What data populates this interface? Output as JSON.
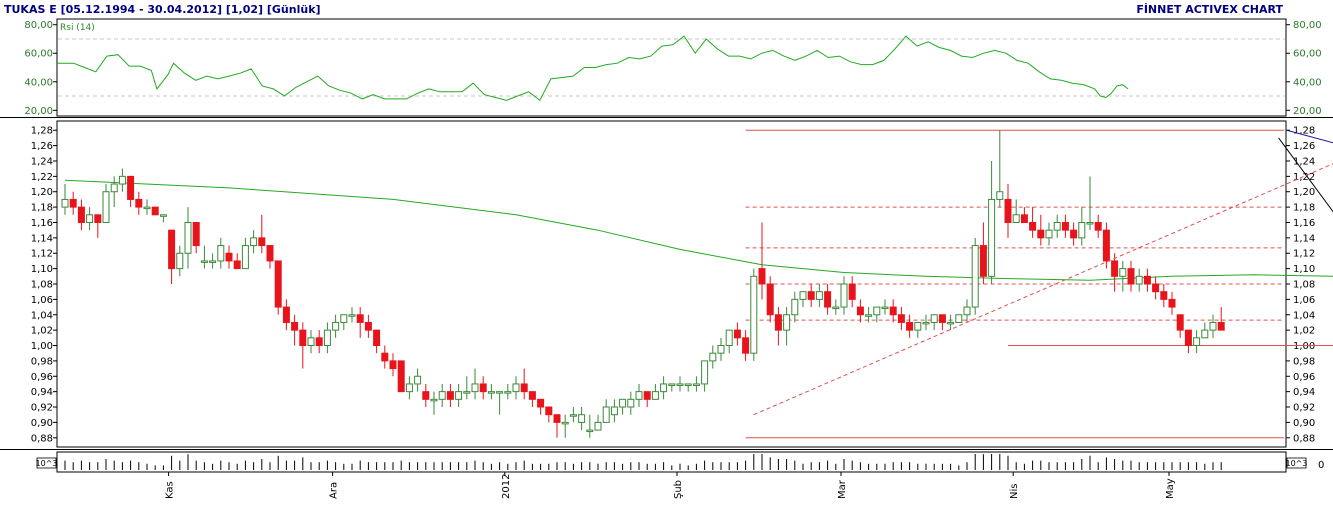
{
  "header": {
    "title": "TUKAS E  [05.12.1994 - 30.04.2012]  [1,02]  [Günlük]",
    "brand": "FİNNET ACTIVEX CHART"
  },
  "colors": {
    "frame": "#000000",
    "up_candle": "#3a8a3a",
    "down_candle": "#e8141c",
    "ma_line": "#22aa22",
    "rsi_line": "#22aa22",
    "level_line": "#e05050",
    "trend_blue": "#1a1a9a",
    "trend_black": "#000000",
    "grid_dash": "#c8c8c8",
    "header_text": "#000080"
  },
  "rsi_panel": {
    "label": "Rsi (14)",
    "ticks": [
      "80,00",
      "60,00",
      "40,00",
      "20,00"
    ],
    "tick_values": [
      80,
      60,
      40,
      20
    ],
    "range": [
      16,
      84
    ]
  },
  "volume_panel": {
    "left_label": "10^3",
    "right_label": "10^3",
    "right_zero": "0"
  },
  "chart_data": {
    "type": "candlestick",
    "y_axis": {
      "range": [
        0.868,
        1.292
      ],
      "ticks": [
        "1,28",
        "1,26",
        "1,24",
        "1,22",
        "1,20",
        "1,18",
        "1,16",
        "1,14",
        "1,12",
        "1,10",
        "1,08",
        "1,06",
        "1,04",
        "1,02",
        "1,00",
        "0,98",
        "0,96",
        "0,94",
        "0,92",
        "0,90",
        "0,88"
      ],
      "tick_values": [
        1.28,
        1.26,
        1.24,
        1.22,
        1.2,
        1.18,
        1.16,
        1.14,
        1.12,
        1.1,
        1.08,
        1.06,
        1.04,
        1.02,
        1.0,
        0.98,
        0.96,
        0.94,
        0.92,
        0.9,
        0.88
      ]
    },
    "x_axis": {
      "months": [
        "Kas",
        "Ara",
        "2012",
        "Şub",
        "Mar",
        "Nis",
        "May"
      ],
      "month_start_index": [
        13,
        33,
        54,
        75,
        95,
        116,
        135
      ]
    },
    "candles": [
      [
        1.18,
        1.21,
        1.17,
        1.19
      ],
      [
        1.19,
        1.2,
        1.17,
        1.18
      ],
      [
        1.18,
        1.19,
        1.15,
        1.16
      ],
      [
        1.16,
        1.18,
        1.15,
        1.17
      ],
      [
        1.17,
        1.17,
        1.14,
        1.16
      ],
      [
        1.16,
        1.21,
        1.16,
        1.2
      ],
      [
        1.2,
        1.22,
        1.18,
        1.21
      ],
      [
        1.21,
        1.23,
        1.2,
        1.22
      ],
      [
        1.22,
        1.22,
        1.18,
        1.19
      ],
      [
        1.19,
        1.2,
        1.17,
        1.18
      ],
      [
        1.18,
        1.19,
        1.17,
        1.18
      ],
      [
        1.18,
        1.18,
        1.17,
        1.17
      ],
      [
        1.17,
        1.17,
        1.16,
        1.17
      ],
      [
        1.15,
        1.15,
        1.08,
        1.1
      ],
      [
        1.1,
        1.13,
        1.09,
        1.12
      ],
      [
        1.12,
        1.18,
        1.1,
        1.16
      ],
      [
        1.16,
        1.16,
        1.12,
        1.13
      ],
      [
        1.11,
        1.13,
        1.1,
        1.11
      ],
      [
        1.11,
        1.12,
        1.1,
        1.11
      ],
      [
        1.11,
        1.14,
        1.1,
        1.13
      ],
      [
        1.12,
        1.13,
        1.1,
        1.11
      ],
      [
        1.11,
        1.12,
        1.1,
        1.1
      ],
      [
        1.1,
        1.14,
        1.1,
        1.13
      ],
      [
        1.13,
        1.15,
        1.12,
        1.14
      ],
      [
        1.14,
        1.17,
        1.12,
        1.13
      ],
      [
        1.13,
        1.13,
        1.1,
        1.11
      ],
      [
        1.11,
        1.11,
        1.04,
        1.05
      ],
      [
        1.05,
        1.06,
        1.02,
        1.03
      ],
      [
        1.03,
        1.04,
        1.0,
        1.02
      ],
      [
        1.02,
        1.03,
        0.97,
        1.0
      ],
      [
        1.0,
        1.02,
        0.99,
        1.01
      ],
      [
        1.01,
        1.02,
        0.99,
        1.0
      ],
      [
        1.0,
        1.03,
        0.99,
        1.02
      ],
      [
        1.02,
        1.04,
        1.01,
        1.03
      ],
      [
        1.03,
        1.04,
        1.02,
        1.04
      ],
      [
        1.04,
        1.05,
        1.03,
        1.04
      ],
      [
        1.04,
        1.05,
        1.01,
        1.03
      ],
      [
        1.03,
        1.04,
        1.01,
        1.02
      ],
      [
        1.02,
        1.02,
        0.99,
        1.0
      ],
      [
        0.99,
        1.0,
        0.97,
        0.98
      ],
      [
        0.98,
        0.99,
        0.96,
        0.97
      ],
      [
        0.98,
        0.98,
        0.94,
        0.94
      ],
      [
        0.94,
        0.96,
        0.93,
        0.95
      ],
      [
        0.95,
        0.97,
        0.94,
        0.96
      ],
      [
        0.94,
        0.95,
        0.92,
        0.93
      ],
      [
        0.93,
        0.94,
        0.91,
        0.93
      ],
      [
        0.93,
        0.95,
        0.92,
        0.94
      ],
      [
        0.94,
        0.95,
        0.92,
        0.93
      ],
      [
        0.93,
        0.95,
        0.92,
        0.94
      ],
      [
        0.94,
        0.96,
        0.93,
        0.94
      ],
      [
        0.94,
        0.97,
        0.93,
        0.95
      ],
      [
        0.95,
        0.96,
        0.93,
        0.94
      ],
      [
        0.94,
        0.95,
        0.93,
        0.94
      ],
      [
        0.94,
        0.94,
        0.91,
        0.94
      ],
      [
        0.94,
        0.95,
        0.93,
        0.94
      ],
      [
        0.94,
        0.96,
        0.93,
        0.95
      ],
      [
        0.95,
        0.97,
        0.93,
        0.94
      ],
      [
        0.94,
        0.94,
        0.92,
        0.93
      ],
      [
        0.93,
        0.93,
        0.91,
        0.92
      ],
      [
        0.92,
        0.92,
        0.9,
        0.91
      ],
      [
        0.91,
        0.91,
        0.88,
        0.9
      ],
      [
        0.9,
        0.91,
        0.88,
        0.9
      ],
      [
        0.91,
        0.92,
        0.9,
        0.91
      ],
      [
        0.9,
        0.92,
        0.89,
        0.91
      ],
      [
        0.89,
        0.91,
        0.88,
        0.89
      ],
      [
        0.89,
        0.91,
        0.89,
        0.9
      ],
      [
        0.9,
        0.93,
        0.9,
        0.92
      ],
      [
        0.91,
        0.93,
        0.9,
        0.92
      ],
      [
        0.92,
        0.93,
        0.91,
        0.93
      ],
      [
        0.92,
        0.94,
        0.91,
        0.93
      ],
      [
        0.93,
        0.95,
        0.92,
        0.94
      ],
      [
        0.94,
        0.94,
        0.92,
        0.93
      ],
      [
        0.93,
        0.95,
        0.93,
        0.94
      ],
      [
        0.94,
        0.96,
        0.93,
        0.95
      ],
      [
        0.95,
        0.95,
        0.94,
        0.95
      ],
      [
        0.95,
        0.96,
        0.94,
        0.95
      ],
      [
        0.95,
        0.95,
        0.94,
        0.95
      ],
      [
        0.95,
        0.96,
        0.94,
        0.95
      ],
      [
        0.95,
        0.98,
        0.94,
        0.98
      ],
      [
        0.98,
        1.0,
        0.97,
        0.99
      ],
      [
        0.99,
        1.01,
        0.98,
        1.0
      ],
      [
        1.0,
        1.02,
        0.99,
        1.02
      ],
      [
        1.02,
        1.03,
        1.0,
        1.01
      ],
      [
        1.01,
        1.02,
        0.98,
        0.99
      ],
      [
        0.99,
        1.1,
        0.98,
        1.09
      ],
      [
        1.1,
        1.16,
        1.06,
        1.08
      ],
      [
        1.08,
        1.09,
        1.03,
        1.04
      ],
      [
        1.04,
        1.05,
        1.0,
        1.02
      ],
      [
        1.02,
        1.05,
        1.0,
        1.04
      ],
      [
        1.04,
        1.07,
        1.03,
        1.06
      ],
      [
        1.06,
        1.07,
        1.05,
        1.07
      ],
      [
        1.07,
        1.08,
        1.05,
        1.06
      ],
      [
        1.06,
        1.08,
        1.05,
        1.07
      ],
      [
        1.07,
        1.08,
        1.04,
        1.05
      ],
      [
        1.05,
        1.06,
        1.04,
        1.05
      ],
      [
        1.05,
        1.09,
        1.04,
        1.08
      ],
      [
        1.08,
        1.09,
        1.05,
        1.06
      ],
      [
        1.05,
        1.06,
        1.03,
        1.04
      ],
      [
        1.04,
        1.05,
        1.03,
        1.04
      ],
      [
        1.04,
        1.05,
        1.03,
        1.05
      ],
      [
        1.05,
        1.06,
        1.04,
        1.05
      ],
      [
        1.05,
        1.06,
        1.03,
        1.04
      ],
      [
        1.04,
        1.05,
        1.02,
        1.03
      ],
      [
        1.03,
        1.04,
        1.01,
        1.02
      ],
      [
        1.02,
        1.03,
        1.01,
        1.03
      ],
      [
        1.03,
        1.04,
        1.02,
        1.03
      ],
      [
        1.03,
        1.04,
        1.02,
        1.04
      ],
      [
        1.04,
        1.04,
        1.02,
        1.03
      ],
      [
        1.03,
        1.04,
        1.02,
        1.03
      ],
      [
        1.03,
        1.04,
        1.03,
        1.04
      ],
      [
        1.04,
        1.06,
        1.03,
        1.05
      ],
      [
        1.05,
        1.14,
        1.04,
        1.13
      ],
      [
        1.13,
        1.16,
        1.08,
        1.09
      ],
      [
        1.09,
        1.24,
        1.08,
        1.19
      ],
      [
        1.19,
        1.28,
        1.18,
        1.2
      ],
      [
        1.19,
        1.21,
        1.14,
        1.16
      ],
      [
        1.16,
        1.19,
        1.16,
        1.17
      ],
      [
        1.17,
        1.18,
        1.16,
        1.16
      ],
      [
        1.16,
        1.18,
        1.14,
        1.15
      ],
      [
        1.15,
        1.17,
        1.13,
        1.14
      ],
      [
        1.14,
        1.16,
        1.13,
        1.15
      ],
      [
        1.15,
        1.17,
        1.14,
        1.16
      ],
      [
        1.16,
        1.17,
        1.14,
        1.15
      ],
      [
        1.15,
        1.16,
        1.13,
        1.14
      ],
      [
        1.14,
        1.18,
        1.13,
        1.16
      ],
      [
        1.16,
        1.22,
        1.15,
        1.16
      ],
      [
        1.16,
        1.17,
        1.14,
        1.15
      ],
      [
        1.15,
        1.16,
        1.1,
        1.11
      ],
      [
        1.11,
        1.12,
        1.07,
        1.09
      ],
      [
        1.09,
        1.11,
        1.07,
        1.1
      ],
      [
        1.1,
        1.11,
        1.07,
        1.08
      ],
      [
        1.08,
        1.1,
        1.07,
        1.09
      ],
      [
        1.09,
        1.1,
        1.07,
        1.08
      ],
      [
        1.08,
        1.09,
        1.06,
        1.07
      ],
      [
        1.07,
        1.08,
        1.05,
        1.06
      ],
      [
        1.06,
        1.07,
        1.04,
        1.05
      ],
      [
        1.04,
        1.04,
        1.01,
        1.02
      ],
      [
        1.02,
        1.02,
        0.99,
        1.0
      ],
      [
        1.0,
        1.02,
        0.99,
        1.01
      ],
      [
        1.01,
        1.03,
        1.01,
        1.02
      ],
      [
        1.02,
        1.04,
        1.01,
        1.03
      ],
      [
        1.03,
        1.05,
        1.02,
        1.02
      ]
    ],
    "moving_average": [
      [
        0,
        1.215
      ],
      [
        20,
        1.205
      ],
      [
        40,
        1.19
      ],
      [
        55,
        1.17
      ],
      [
        65,
        1.15
      ],
      [
        75,
        1.125
      ],
      [
        85,
        1.105
      ],
      [
        95,
        1.095
      ],
      [
        105,
        1.09
      ],
      [
        115,
        1.087
      ],
      [
        125,
        1.085
      ],
      [
        135,
        1.09
      ],
      [
        145,
        1.092
      ],
      [
        155,
        1.09
      ]
    ],
    "rsi": [
      [
        0,
        53
      ],
      [
        3,
        53
      ],
      [
        5,
        50
      ],
      [
        7,
        47
      ],
      [
        9,
        58
      ],
      [
        11,
        59
      ],
      [
        13,
        51
      ],
      [
        15,
        51
      ],
      [
        17,
        48
      ],
      [
        18,
        35
      ],
      [
        20,
        45
      ],
      [
        21,
        53
      ],
      [
        23,
        46
      ],
      [
        25,
        41
      ],
      [
        27,
        44
      ],
      [
        29,
        42
      ],
      [
        31,
        44
      ],
      [
        33,
        46
      ],
      [
        35,
        49
      ],
      [
        37,
        37
      ],
      [
        39,
        35
      ],
      [
        41,
        30
      ],
      [
        43,
        36
      ],
      [
        45,
        40
      ],
      [
        47,
        44
      ],
      [
        49,
        37
      ],
      [
        51,
        34
      ],
      [
        53,
        32
      ],
      [
        55,
        28
      ],
      [
        57,
        31
      ],
      [
        59,
        28
      ],
      [
        61,
        28
      ],
      [
        63,
        28
      ],
      [
        65,
        32
      ],
      [
        67,
        35
      ],
      [
        69,
        33
      ],
      [
        71,
        33
      ],
      [
        73,
        33
      ],
      [
        75,
        39
      ],
      [
        77,
        31
      ],
      [
        79,
        29
      ],
      [
        81,
        27
      ],
      [
        83,
        30
      ],
      [
        85,
        33
      ],
      [
        87,
        27
      ],
      [
        89,
        42
      ],
      [
        91,
        43
      ],
      [
        93,
        44
      ],
      [
        95,
        50
      ],
      [
        97,
        50
      ],
      [
        99,
        52
      ],
      [
        101,
        53
      ],
      [
        103,
        57
      ],
      [
        105,
        56
      ],
      [
        107,
        58
      ],
      [
        109,
        65
      ],
      [
        111,
        66
      ],
      [
        113,
        72
      ],
      [
        115,
        60
      ],
      [
        117,
        70
      ],
      [
        119,
        63
      ],
      [
        121,
        58
      ],
      [
        123,
        58
      ],
      [
        125,
        56
      ],
      [
        127,
        60
      ],
      [
        129,
        62
      ],
      [
        131,
        58
      ],
      [
        133,
        55
      ],
      [
        135,
        58
      ],
      [
        137,
        62
      ],
      [
        139,
        57
      ],
      [
        141,
        58
      ],
      [
        143,
        54
      ],
      [
        145,
        52
      ],
      [
        147,
        52
      ],
      [
        149,
        55
      ],
      [
        151,
        63
      ],
      [
        153,
        72
      ],
      [
        155,
        65
      ],
      [
        157,
        68
      ],
      [
        159,
        64
      ],
      [
        161,
        62
      ],
      [
        163,
        58
      ],
      [
        165,
        57
      ],
      [
        167,
        60
      ],
      [
        169,
        62
      ],
      [
        171,
        60
      ],
      [
        173,
        55
      ],
      [
        175,
        53
      ],
      [
        177,
        47
      ],
      [
        179,
        42
      ],
      [
        181,
        41
      ],
      [
        183,
        39
      ],
      [
        185,
        38
      ],
      [
        187,
        35
      ],
      [
        188,
        30
      ],
      [
        189,
        29
      ],
      [
        190,
        32
      ],
      [
        191,
        37
      ],
      [
        192,
        38
      ],
      [
        193,
        35
      ]
    ],
    "rsi_x_span": 193,
    "horizontal_levels": [
      {
        "y": 1.28,
        "from_index": 83
      },
      {
        "y": 1.18,
        "from_index": 83,
        "dashed": true
      },
      {
        "y": 1.127,
        "from_index": 83,
        "dashed": true
      },
      {
        "y": 1.08,
        "from_index": 83,
        "dashed": true
      },
      {
        "y": 1.033,
        "from_index": 83,
        "dashed": true
      },
      {
        "y": 1.0,
        "from_index": 115,
        "to_index": 189
      },
      {
        "y": 0.88,
        "from_index": 83
      }
    ],
    "trend_lines": [
      {
        "color": "blue",
        "from": [
          149,
          1.28
        ],
        "to": [
          210,
          1.104
        ]
      },
      {
        "color": "black",
        "from": [
          148,
          1.27
        ],
        "to": [
          157,
          1.14
        ]
      },
      {
        "color": "black",
        "from": [
          157,
          1.14
        ],
        "to": [
          166,
          1.226
        ]
      },
      {
        "color": "black",
        "from": [
          166,
          1.226
        ],
        "to": [
          180,
          0.99
        ]
      },
      {
        "color": "reddash",
        "from": [
          84,
          0.91
        ],
        "to": [
          163,
          1.275
        ]
      }
    ]
  }
}
